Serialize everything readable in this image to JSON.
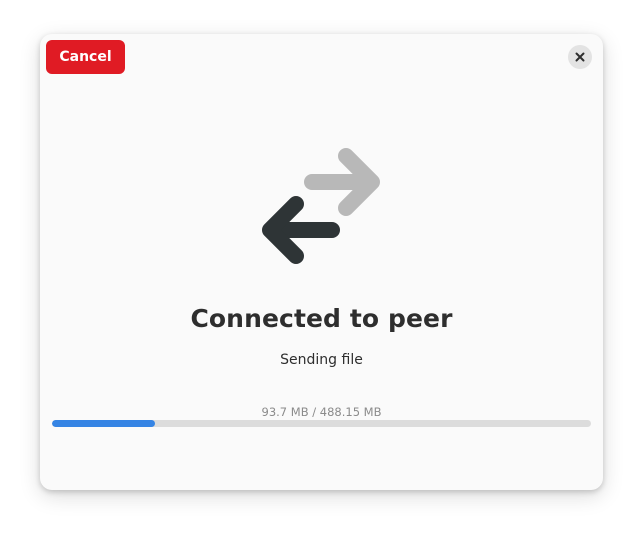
{
  "header": {
    "cancel_label": "Cancel",
    "close_icon": "close-icon",
    "cancel_color": "#e01b24"
  },
  "main": {
    "icon": "transfer-arrows-icon",
    "title": "Connected to peer",
    "subtitle": "Sending file"
  },
  "progress": {
    "text": "93.7 MB / 488.15 MB",
    "fraction": 0.192,
    "color": "#3584e4"
  }
}
